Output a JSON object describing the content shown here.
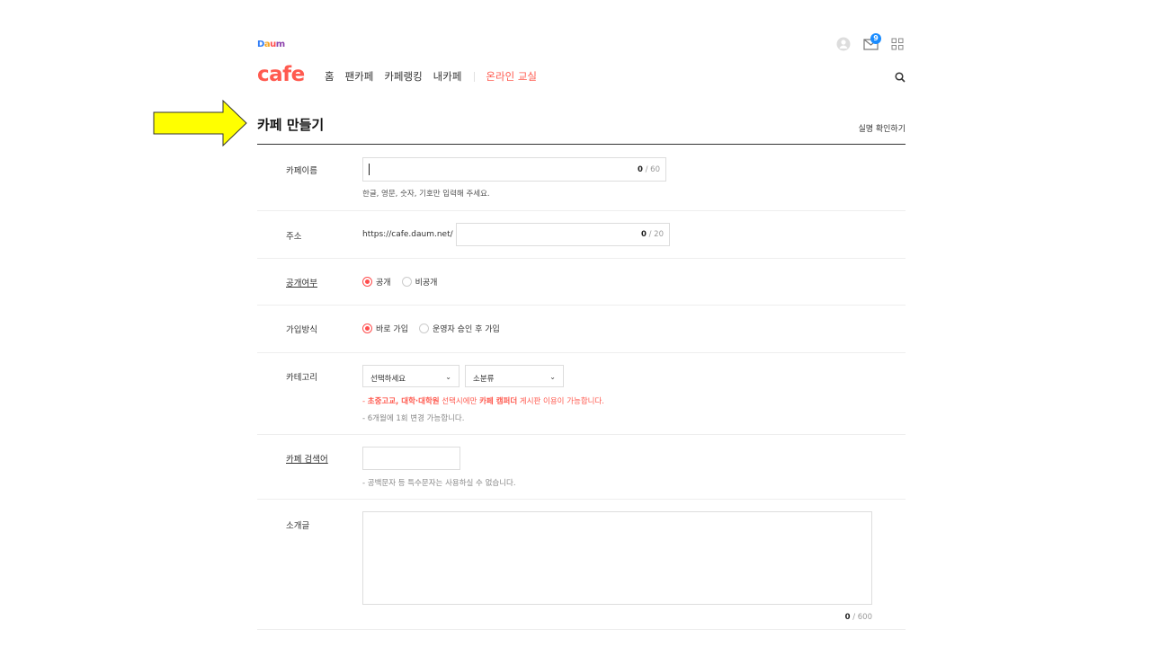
{
  "header": {
    "daum_logo": [
      "D",
      "a",
      "u",
      "m"
    ],
    "mail_count": "9",
    "cafe_logo": "cafe",
    "nav": [
      "홈",
      "팬카페",
      "카페랭킹",
      "내카페"
    ],
    "nav_accent": "온라인 교실"
  },
  "page": {
    "title": "카페 만들기",
    "title_link": "실명 확인하기"
  },
  "form": {
    "name": {
      "label": "카페이름",
      "count": "0",
      "max": "/ 60",
      "help": "한글, 영문, 숫자, 기호만 입력해 주세요."
    },
    "address": {
      "label": "주소",
      "prefix": "https://cafe.daum.net/",
      "count": "0",
      "max": "/ 20"
    },
    "visibility": {
      "label": "공개여부",
      "options": [
        "공개",
        "비공개"
      ],
      "selected": "공개"
    },
    "join": {
      "label": "가입방식",
      "options": [
        "바로 가입",
        "운영자 승인 후 가입"
      ],
      "selected": "바로 가입"
    },
    "category": {
      "label": "카테고리",
      "select1": "선택하세요",
      "select2": "소분류",
      "notice_prefix": "- ",
      "notice_bold1": "초중고교, 대학·대학원",
      "notice_mid": " 선택시에만 ",
      "notice_bold2": "카페 캠퍼더",
      "notice_tail": " 게시판 이용이 가능합니다.",
      "notice2": "- 6개월에 1회 변경 가능합니다."
    },
    "keyword": {
      "label": "카페 검색어",
      "help": "- 공백문자 등 특수문자는 사용하실 수 없습니다."
    },
    "intro": {
      "label": "소개글",
      "count": "0",
      "max": "/ 600"
    }
  },
  "colors": {
    "accent": "#ff5a4f",
    "arrow_fill": "#ffff00",
    "badge": "#1a8cff"
  },
  "icons": [
    "user-icon",
    "mail-icon",
    "apps-grid-icon",
    "search-icon",
    "arrow-pointer-icon",
    "chevron-down-icon"
  ]
}
